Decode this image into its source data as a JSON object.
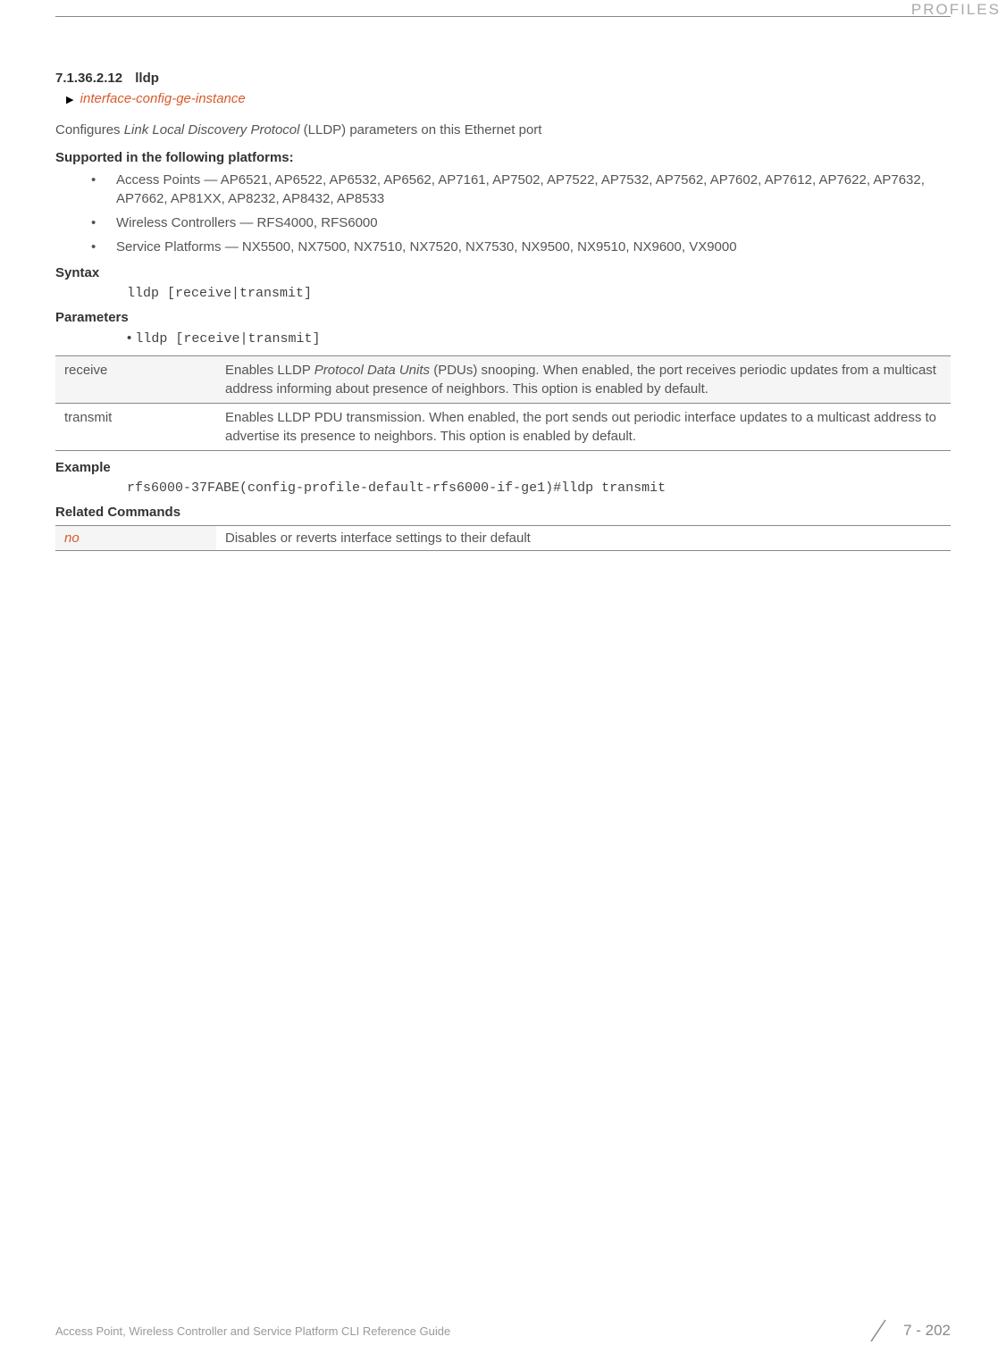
{
  "header": {
    "section_label": "PROFILES"
  },
  "section": {
    "number": "7.1.36.2.12",
    "title": "lldp",
    "breadcrumb": "interface-config-ge-instance",
    "description_prefix": "Configures ",
    "description_italic": "Link Local Discovery Protocol",
    "description_suffix": " (LLDP) parameters on this Ethernet port"
  },
  "supported": {
    "heading": "Supported in the following platforms:",
    "items": [
      "Access Points — AP6521, AP6522, AP6532, AP6562, AP7161, AP7502, AP7522, AP7532, AP7562, AP7602, AP7612, AP7622, AP7632, AP7662, AP81XX, AP8232, AP8432, AP8533",
      "Wireless Controllers — RFS4000, RFS6000",
      "Service Platforms — NX5500, NX7500, NX7510, NX7520, NX7530, NX9500, NX9510, NX9600, VX9000"
    ]
  },
  "syntax": {
    "heading": "Syntax",
    "code": "lldp [receive|transmit]"
  },
  "parameters": {
    "heading": "Parameters",
    "bullet": "lldp [receive|transmit]",
    "rows": [
      {
        "key": "receive",
        "desc_prefix": "Enables LLDP ",
        "desc_italic": "Protocol Data Units",
        "desc_suffix": " (PDUs) snooping. When enabled, the port receives periodic updates from a multicast address informing about presence of neighbors. This option is enabled by default."
      },
      {
        "key": "transmit",
        "desc_prefix": "",
        "desc_italic": "",
        "desc_suffix": "Enables LLDP PDU transmission. When enabled, the port sends out periodic interface updates to a multicast address to advertise its presence to neighbors. This option is enabled by default."
      }
    ]
  },
  "example": {
    "heading": "Example",
    "code": "rfs6000-37FABE(config-profile-default-rfs6000-if-ge1)#lldp transmit"
  },
  "related": {
    "heading": "Related Commands",
    "rows": [
      {
        "key": "no",
        "desc": "Disables or reverts interface settings to their default"
      }
    ]
  },
  "footer": {
    "title": "Access Point, Wireless Controller and Service Platform CLI Reference Guide",
    "page": "7 - 202"
  }
}
